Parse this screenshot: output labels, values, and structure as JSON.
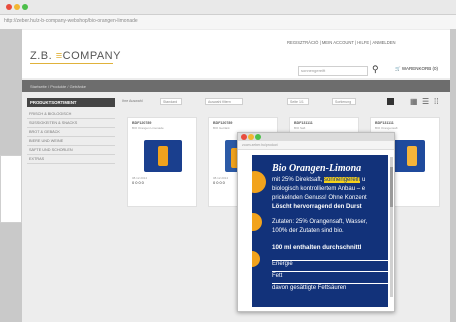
{
  "browser": {
    "url": "http://zeber.hu/z-b-company-webshop/bio-orangen-limonade",
    "dot_colors": [
      "#e84c3d",
      "#f2b632",
      "#4cbf4a"
    ]
  },
  "header": {
    "logo": "Z.B.",
    "company": "COMPANY",
    "topnav": "REGISZTRÁCIÓ | MEIN ACCOUNT | HILFE | ANMELDEN",
    "search_placeholder": "sonnengereift",
    "search_icon": "search-icon",
    "cart_label": "WARENKORB (0)"
  },
  "breadcrumb": "Startseite / Produkte / Getränke",
  "sidebar": {
    "title": "PRODUKTSORTIMENT",
    "items": [
      "FRISCH & BIOLOGISCH",
      "SÜSSIGKEITEN & SNACKS",
      "BROT & GEBÄCK",
      "BIERE UND WEINE",
      "SÄFTE UND SCHORLEN",
      "EXTRAS"
    ]
  },
  "filters": {
    "label": "Ihre Auswahl",
    "sort": "Standard",
    "items": "Auswahl filtern",
    "page": "Seite 1/1",
    "order": "Sortierung"
  },
  "products": [
    {
      "code": "BDF120789",
      "sub": "BIO Orangen Limonade",
      "date": "08.12.2014",
      "qty": "0000"
    },
    {
      "code": "BDF120789",
      "sub": "BIO Getränk",
      "date": "08.12.2014",
      "qty": "0000"
    },
    {
      "code": "BDF131111",
      "sub": "BIO Saft",
      "date": "08.12.2014",
      "qty": "0000"
    },
    {
      "code": "BDF131111",
      "sub": "BIO Orangensaft",
      "date": "08.12.2014",
      "qty": "0000"
    }
  ],
  "popup": {
    "url": "zoom.zeber.hu/product",
    "line1": "Bio Orangen-Limona",
    "line2_pre": "mit 25% Direktsaft, ",
    "line2_hl": "sonnengereift",
    "line2_post": " u",
    "line3": "biologisch kontrolliertem Anbau – e",
    "line4": "prickelnden Genuss! Ohne Konzent",
    "line5": "Löscht hervorragend den Durst",
    "line6": "Zutaten: 25% Orangensaft, Wasser,",
    "line7": "100% der Zutaten sind bio.",
    "nutri_title": "100 ml enthalten durchschnittl",
    "nutri_rows": [
      "Energie",
      "Fett",
      "davon gesättigte Fettsäuren"
    ]
  }
}
